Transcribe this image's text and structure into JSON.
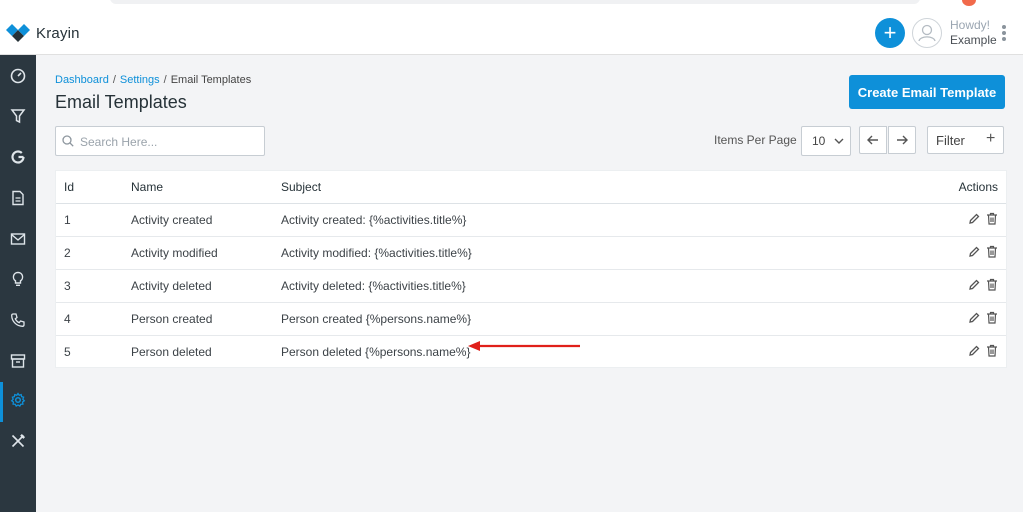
{
  "app": {
    "name": "Krayin"
  },
  "header": {
    "greeting": "Howdy!",
    "username": "Example",
    "add_label": "+"
  },
  "sidebar": {
    "items": [
      {
        "name": "dashboard-icon"
      },
      {
        "name": "leads-funnel-icon"
      },
      {
        "name": "google-icon"
      },
      {
        "name": "quotes-document-icon"
      },
      {
        "name": "mail-icon"
      },
      {
        "name": "activities-bulb-icon"
      },
      {
        "name": "contacts-phone-icon"
      },
      {
        "name": "products-archive-icon"
      },
      {
        "name": "settings-gear-icon"
      },
      {
        "name": "configuration-tools-icon"
      }
    ],
    "active": "settings-gear-icon"
  },
  "breadcrumb": {
    "dashboard": "Dashboard",
    "settings": "Settings",
    "current": "Email Templates",
    "separator": "/"
  },
  "page": {
    "title": "Email Templates",
    "create_label": "Create Email Template"
  },
  "toolbar": {
    "search_placeholder": "Search Here...",
    "items_per_page_label": "Items Per Page",
    "items_per_page_value": "10",
    "filter_label": "Filter",
    "filter_plus": "+"
  },
  "table": {
    "headers": {
      "id": "Id",
      "name": "Name",
      "subject": "Subject",
      "actions": "Actions"
    },
    "rows": [
      {
        "id": "1",
        "name": "Activity created",
        "subject": "Activity created: {%activities.title%}"
      },
      {
        "id": "2",
        "name": "Activity modified",
        "subject": "Activity modified: {%activities.title%}"
      },
      {
        "id": "3",
        "name": "Activity deleted",
        "subject": "Activity deleted: {%activities.title%}"
      },
      {
        "id": "4",
        "name": "Person created",
        "subject": "Person created {%persons.name%}"
      },
      {
        "id": "5",
        "name": "Person deleted",
        "subject": "Person deleted {%persons.name%}"
      }
    ]
  },
  "colors": {
    "accent": "#0e90d9",
    "sidebar": "#2b3740",
    "annotation_arrow": "#e0201a"
  }
}
